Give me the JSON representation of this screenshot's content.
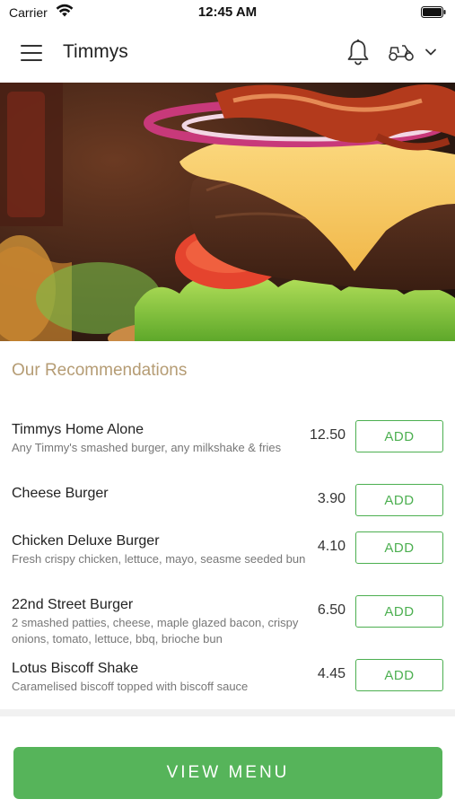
{
  "status_bar": {
    "carrier": "Carrier",
    "time": "12:45 AM",
    "icons": [
      "wifi-icon",
      "battery-icon"
    ]
  },
  "header": {
    "title": "Timmys",
    "icons": [
      "menu-icon",
      "bell-icon",
      "scooter-icon",
      "chevron-down-icon"
    ]
  },
  "hero": {
    "image": "burger-photo"
  },
  "recommendations": {
    "title": "Our Recommendations",
    "items": [
      {
        "name": "Timmys Home Alone",
        "description": "Any Timmy's smashed burger, any milkshake & fries",
        "price": "12.50",
        "add_label": "ADD"
      },
      {
        "name": "Cheese Burger",
        "description": "",
        "price": "3.90",
        "add_label": "ADD"
      },
      {
        "name": "Chicken Deluxe Burger",
        "description": "Fresh crispy chicken, lettuce, mayo, seasme seeded bun",
        "price": "4.10",
        "add_label": "ADD"
      },
      {
        "name": "22nd Street Burger",
        "description": "2 smashed patties, cheese, maple glazed bacon, crispy onions, tomato, lettuce, bbq, brioche bun",
        "price": "6.50",
        "add_label": "ADD"
      },
      {
        "name": "Lotus Biscoff Shake",
        "description": "Caramelised biscoff topped with biscoff sauce",
        "price": "4.45",
        "add_label": "ADD"
      }
    ]
  },
  "footer": {
    "view_menu_label": "VIEW MENU"
  },
  "colors": {
    "accent_green": "#4caf50",
    "button_green": "#56b45a",
    "section_title": "#b59c74"
  }
}
